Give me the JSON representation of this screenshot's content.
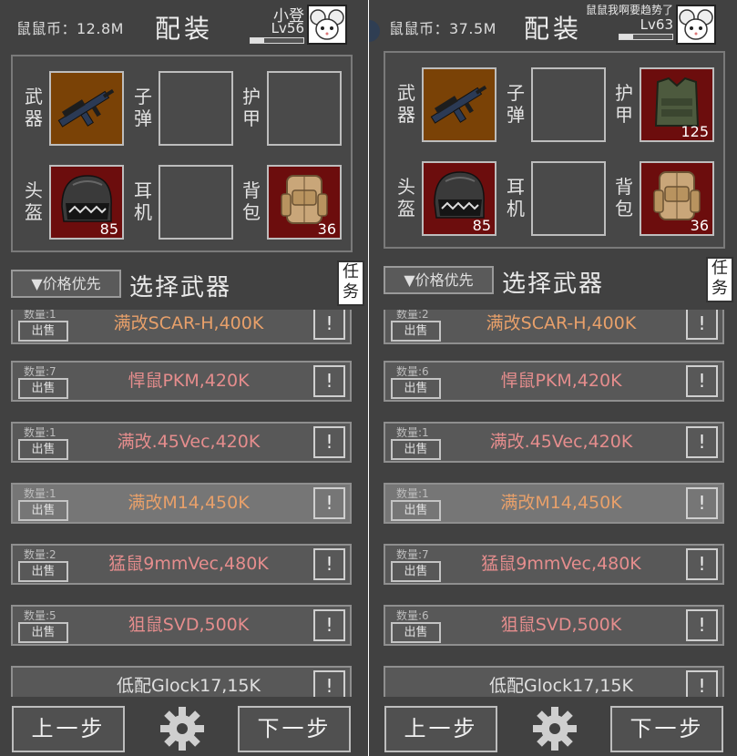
{
  "colors": {
    "panel_bg": "#414141",
    "accent_orange": "#e8a06a",
    "accent_pink": "#e58d8d",
    "item_bg": "#585858",
    "slot_brown": "#7a4206",
    "slot_red": "#6c0d0d"
  },
  "slot_labels": {
    "weapon": "武器",
    "ammo": "子弹",
    "armor": "护甲",
    "helmet": "头盔",
    "earphone": "耳机",
    "backpack": "背包"
  },
  "sort_label": "▼价格优先",
  "select_title": "选择武器",
  "task_label": "任务",
  "sell_label": "出售",
  "info_label": "!",
  "title": "配装",
  "nav": {
    "prev": "上一步",
    "next": "下一步"
  },
  "screens": [
    {
      "coins": "鼠鼠币：12.8M",
      "player_name": "小登",
      "level": "Lv56",
      "xp_fraction": 0.25,
      "slots": {
        "weapon": {
          "icon": "rifle-icon",
          "value": ""
        },
        "ammo": {
          "icon": "",
          "value": ""
        },
        "armor": {
          "icon": "",
          "value": ""
        },
        "helmet": {
          "icon": "helmet-icon",
          "value": "85"
        },
        "earphone": {
          "icon": "",
          "value": ""
        },
        "backpack": {
          "icon": "backpack-icon",
          "value": "36"
        }
      },
      "items": [
        {
          "qty": "数量:1",
          "name": "满改SCAR-H,400K",
          "color": "orange",
          "highlight": false
        },
        {
          "qty": "数量:7",
          "name": "悍鼠PKM,420K",
          "color": "pink",
          "highlight": false
        },
        {
          "qty": "数量:1",
          "name": "满改.45Vec,420K",
          "color": "pink",
          "highlight": false
        },
        {
          "qty": "数量:1",
          "name": "满改M14,450K",
          "color": "orange",
          "highlight": true
        },
        {
          "qty": "数量:2",
          "name": "猛鼠9mmVec,480K",
          "color": "pink",
          "highlight": false
        },
        {
          "qty": "数量:5",
          "name": "狙鼠SVD,500K",
          "color": "pink",
          "highlight": false
        },
        {
          "qty": "",
          "name": "低配Glock17,15K",
          "color": "white",
          "highlight": false
        }
      ]
    },
    {
      "coins": "鼠鼠币：37.5M",
      "player_name": "鼠鼠我啊要趋势了",
      "level": "Lv63",
      "xp_fraction": 0.25,
      "slots": {
        "weapon": {
          "icon": "rifle-icon",
          "value": ""
        },
        "ammo": {
          "icon": "",
          "value": ""
        },
        "armor": {
          "icon": "armor-vest-icon",
          "value": "125"
        },
        "helmet": {
          "icon": "helmet-icon",
          "value": "85"
        },
        "earphone": {
          "icon": "",
          "value": ""
        },
        "backpack": {
          "icon": "backpack-icon",
          "value": "36"
        }
      },
      "items": [
        {
          "qty": "数量:2",
          "name": "满改SCAR-H,400K",
          "color": "orange",
          "highlight": false
        },
        {
          "qty": "数量:6",
          "name": "悍鼠PKM,420K",
          "color": "pink",
          "highlight": false
        },
        {
          "qty": "数量:1",
          "name": "满改.45Vec,420K",
          "color": "pink",
          "highlight": false
        },
        {
          "qty": "数量:1",
          "name": "满改M14,450K",
          "color": "orange",
          "highlight": true
        },
        {
          "qty": "数量:7",
          "name": "猛鼠9mmVec,480K",
          "color": "pink",
          "highlight": false
        },
        {
          "qty": "数量:6",
          "name": "狙鼠SVD,500K",
          "color": "pink",
          "highlight": false
        },
        {
          "qty": "",
          "name": "低配Glock17,15K",
          "color": "white",
          "highlight": false
        }
      ]
    }
  ]
}
